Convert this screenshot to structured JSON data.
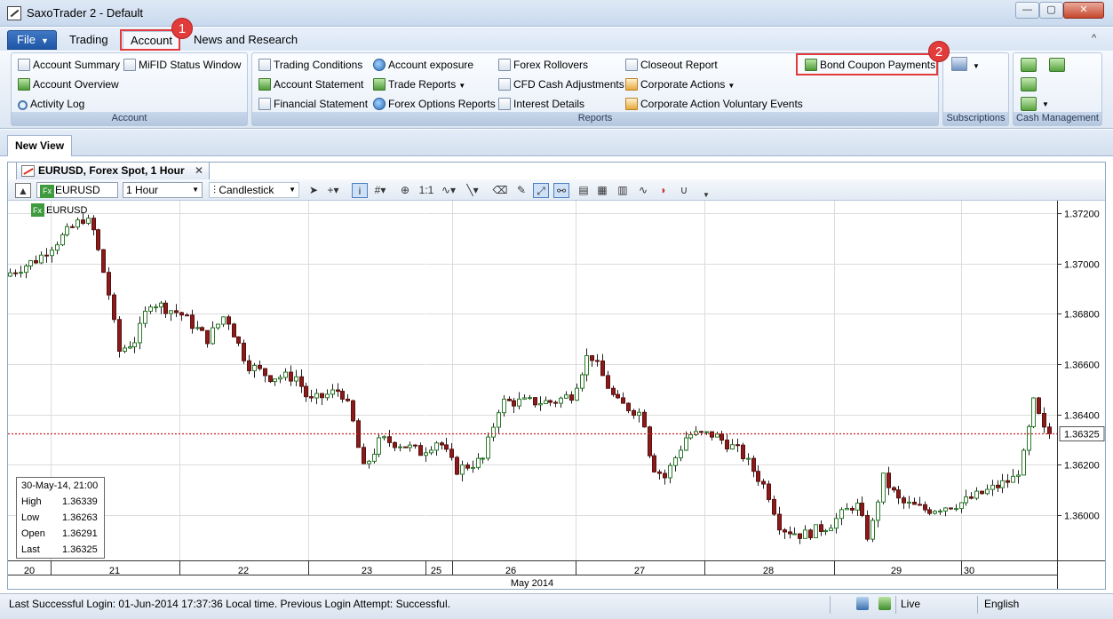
{
  "window": {
    "title": "SaxoTrader 2 - Default",
    "min": "—",
    "max": "▢",
    "close": "✕"
  },
  "ribbon_tabs": {
    "file": "File",
    "file_arrow": "▼",
    "trading": "Trading",
    "account": "Account",
    "news": "News and Research",
    "collapse": "^"
  },
  "badges": {
    "one": "1",
    "two": "2"
  },
  "account_group": {
    "label": "Account",
    "items": [
      "Account Summary",
      "MiFID Status Window",
      "Account Overview",
      "Activity Log"
    ]
  },
  "reports_group": {
    "label": "Reports",
    "items": [
      "Trading Conditions",
      "Account exposure",
      "Forex Rollovers",
      "Closeout Report",
      "Bond Coupon Payments",
      "Account Statement",
      "Trade Reports",
      "CFD Cash Adjustments",
      "Corporate Actions",
      "Financial Statement",
      "Forex Options Reports",
      "Interest Details",
      "Corporate Action Voluntary Events"
    ]
  },
  "subscriptions_group": {
    "label": "Subscriptions"
  },
  "cash_group": {
    "label": "Cash Management"
  },
  "view_tab": "New View",
  "chart_tab": {
    "title": "EURUSD, Forex Spot, 1 Hour",
    "close": "✕"
  },
  "chart_toolbar": {
    "instrument": "EURUSD",
    "fx": "Fx",
    "interval": "1 Hour",
    "chart_type": "Candlestick"
  },
  "chart_data": {
    "type": "candlestick",
    "instrument_label": "EURUSD",
    "y_ticks": [
      "1.37200",
      "1.37000",
      "1.36800",
      "1.36600",
      "1.36400",
      "1.36200",
      "1.36000"
    ],
    "ylim": [
      1.3582,
      1.3725
    ],
    "last_price": 1.36325,
    "last_price_label": "1.36325",
    "day_labels": [
      "20",
      "21",
      "22",
      "23",
      "25",
      "26",
      "27",
      "28",
      "29",
      "30"
    ],
    "month_label": "May 2014"
  },
  "ohlc_box": {
    "date": "30-May-14, 21:00",
    "rows": [
      {
        "k": "High",
        "v": "1.36339"
      },
      {
        "k": "Low",
        "v": "1.36263"
      },
      {
        "k": "Open",
        "v": "1.36291"
      },
      {
        "k": "Last",
        "v": "1.36325"
      }
    ]
  },
  "status": {
    "login": "Last Successful Login: 01-Jun-2014 17:37:36 Local time. Previous Login Attempt: Successful.",
    "live": "Live",
    "language": "English"
  }
}
